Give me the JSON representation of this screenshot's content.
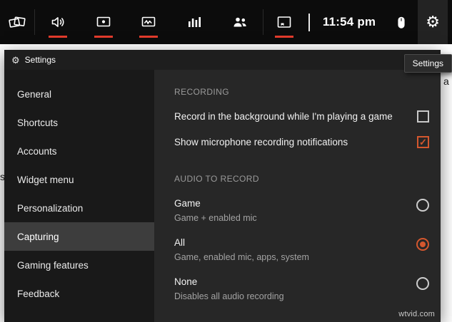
{
  "colors": {
    "accent_underline": "#e23b2c",
    "accent_control": "#d4572e",
    "gamebar_bg": "#0c0c0c",
    "window_bg": "#272727",
    "sidebar_bg": "#191919",
    "selected_item_bg": "#3d3d3d"
  },
  "gamebar": {
    "time": "11:54 pm",
    "icons": [
      {
        "name": "widgets-menu-icon",
        "active_underline": false
      },
      {
        "name": "speaker-audio-icon",
        "active_underline": true
      },
      {
        "name": "capture-monitor-icon",
        "active_underline": true
      },
      {
        "name": "performance-monitor-icon",
        "active_underline": true
      },
      {
        "name": "resources-bar-chart-icon",
        "active_underline": false
      },
      {
        "name": "social-people-icon",
        "active_underline": false
      },
      {
        "name": "gallery-icon",
        "active_underline": true
      },
      {
        "name": "mouse-icon",
        "active_underline": false
      },
      {
        "name": "settings-gear-icon",
        "active_underline": false
      }
    ]
  },
  "tooltip": {
    "text": "Settings"
  },
  "settings": {
    "title": "Settings",
    "sidebar": {
      "items": [
        "General",
        "Shortcuts",
        "Accounts",
        "Widget menu",
        "Personalization",
        "Capturing",
        "Gaming features",
        "Feedback"
      ],
      "selected_item": "Capturing"
    },
    "content": {
      "sections": [
        {
          "header": "RECORDING",
          "rows": [
            {
              "label": "Record in the background while I'm playing a game",
              "control": "checkbox",
              "checked": false
            },
            {
              "label": "Show microphone recording notifications",
              "control": "checkbox",
              "checked": true
            }
          ]
        },
        {
          "header": "AUDIO TO RECORD",
          "rows": [
            {
              "label": "Game",
              "description": "Game + enabled mic",
              "control": "radio",
              "selected": false
            },
            {
              "label": "All",
              "description": "Game, enabled mic, apps, system",
              "control": "radio",
              "selected": true
            },
            {
              "label": "None",
              "description": "Disables all audio recording",
              "control": "radio",
              "selected": false
            }
          ]
        }
      ]
    }
  },
  "watermark": "wtvid.com",
  "background_fragments": {
    "left_text": "s",
    "right_text": "a"
  }
}
